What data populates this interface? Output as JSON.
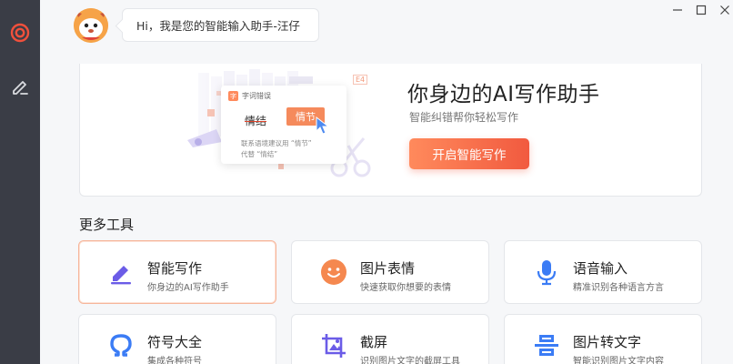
{
  "header": {
    "greeting": "Hi，我是您的智能输入助手-汪仔"
  },
  "hero": {
    "title": "你身边的AI写作助手",
    "subtitle": "智能纠错帮你轻松写作",
    "button_label": "开启智能写作",
    "demo": {
      "tag": "字词错误",
      "tag_icon": "字",
      "wrong_word": "情结",
      "correct_word": "情节",
      "note_line1": "联系语境建议用 “情节”",
      "note_line2": "代替 “情结”",
      "side_tag": "E4"
    }
  },
  "section_title": "更多工具",
  "tools": [
    {
      "name": "智能写作",
      "desc": "你身边的AI写作助手",
      "icon": "pen-icon",
      "active": true
    },
    {
      "name": "图片表情",
      "desc": "快速获取你想要的表情",
      "icon": "smiley-icon"
    },
    {
      "name": "语音输入",
      "desc": "精准识别各种语言方言",
      "icon": "microphone-icon"
    },
    {
      "name": "符号大全",
      "desc": "集成各种符号",
      "icon": "omega-icon"
    },
    {
      "name": "截屏",
      "desc": "识别图片文字的截屏工具",
      "icon": "screenshot-icon"
    },
    {
      "name": "图片转文字",
      "desc": "智能识别图片文字内容",
      "icon": "ocr-scan-icon"
    }
  ],
  "colors": {
    "sidebar": "#3a3d46",
    "accent_orange": "#f15a3f",
    "accent_blue": "#3b7cf5",
    "accent_purple": "#6b5ce7"
  }
}
